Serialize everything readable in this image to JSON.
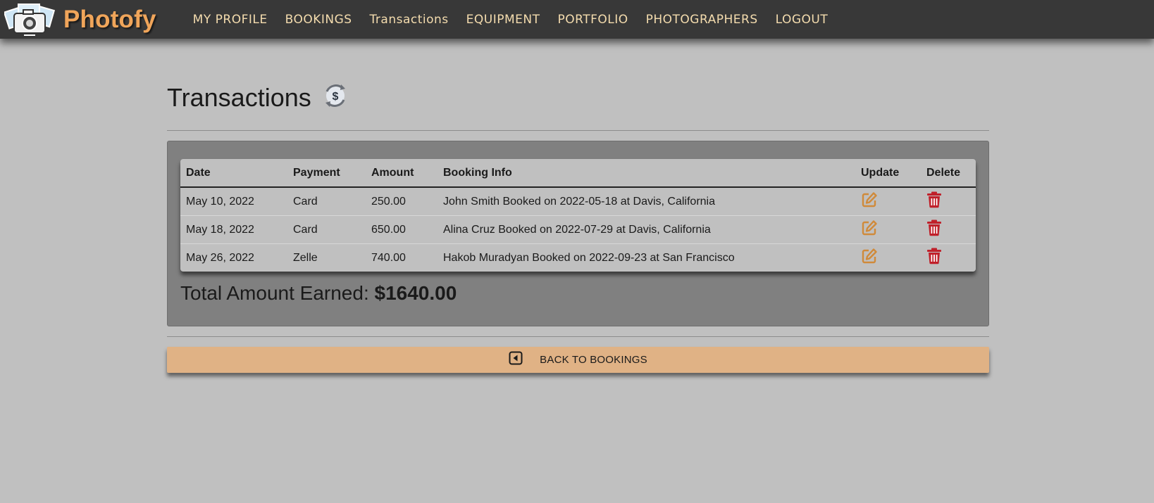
{
  "app": {
    "brand_name": "Photofy",
    "brand_color": "#f0a55a"
  },
  "nav": {
    "items": [
      {
        "label": "MY PROFILE"
      },
      {
        "label": "BOOKINGS"
      },
      {
        "label": "Transactions"
      },
      {
        "label": "EQUIPMENT"
      },
      {
        "label": "PORTFOLIO"
      },
      {
        "label": "PHOTOGRAPHERS"
      },
      {
        "label": "LOGOUT"
      }
    ]
  },
  "page": {
    "title": "Transactions",
    "title_icon": "dollar-refresh-icon"
  },
  "table": {
    "headers": {
      "date": "Date",
      "payment": "Payment",
      "amount": "Amount",
      "booking_info": "Booking Info",
      "update": "Update",
      "delete": "Delete"
    },
    "rows": [
      {
        "date": "May 10, 2022",
        "payment": "Card",
        "amount": "250.00",
        "booking_info": "John Smith Booked on 2022-05-18 at Davis, California",
        "update_icon": "edit-icon",
        "delete_icon": "trash-icon"
      },
      {
        "date": "May 18, 2022",
        "payment": "Card",
        "amount": "650.00",
        "booking_info": "Alina Cruz Booked on 2022-07-29 at Davis, California",
        "update_icon": "edit-icon",
        "delete_icon": "trash-icon"
      },
      {
        "date": "May 26, 2022",
        "payment": "Zelle",
        "amount": "740.00",
        "booking_info": "Hakob Muradyan Booked on 2022-09-23 at San Francisco",
        "update_icon": "edit-icon",
        "delete_icon": "trash-icon"
      }
    ]
  },
  "summary": {
    "total_label": "Total Amount Earned:",
    "total_value": "$1640.00"
  },
  "actions": {
    "back_label": "BACK TO BOOKINGS",
    "back_icon": "caret-left-square-icon"
  },
  "colors": {
    "navbar_bg": "#383838",
    "nav_text": "#f4dcae",
    "page_bg": "#c0c0c0",
    "panel_bg": "#808080",
    "button_bg": "#e0b285",
    "edit_icon": "#d08a3a",
    "delete_icon": "#c0202a"
  }
}
